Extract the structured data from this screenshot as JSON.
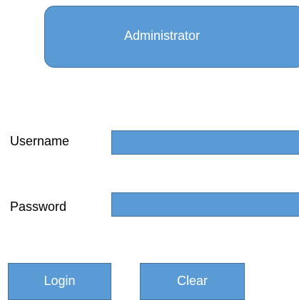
{
  "header": {
    "title": "Administrator"
  },
  "form": {
    "username_label": "Username",
    "username_value": "",
    "password_label": "Password",
    "password_value": ""
  },
  "actions": {
    "login_label": "Login",
    "clear_label": "Clear"
  },
  "colors": {
    "accent": "#5b9bd5",
    "border": "#41719c",
    "text_on_accent": "#ffffff",
    "label_text": "#000000"
  }
}
